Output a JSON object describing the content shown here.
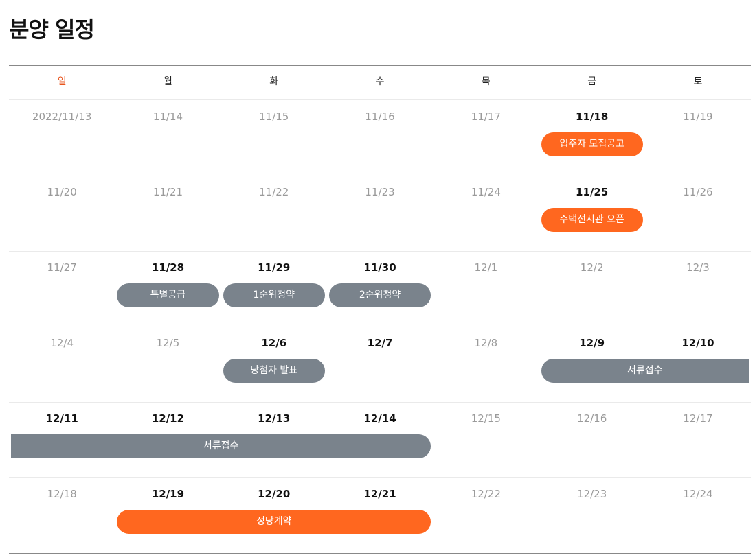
{
  "page": {
    "title": "분양 일정"
  },
  "colors": {
    "accent": "#ff671f",
    "neutral": "#7a838c",
    "sunday": "#e8551e"
  },
  "calendar": {
    "weekdays": [
      "일",
      "월",
      "화",
      "수",
      "목",
      "금",
      "토"
    ],
    "weeks": [
      {
        "dates": [
          {
            "label": "2022/11/13",
            "active": false
          },
          {
            "label": "11/14",
            "active": false
          },
          {
            "label": "11/15",
            "active": false
          },
          {
            "label": "11/16",
            "active": false
          },
          {
            "label": "11/17",
            "active": false
          },
          {
            "label": "11/18",
            "active": true
          },
          {
            "label": "11/19",
            "active": false
          }
        ],
        "events": [
          {
            "label": "입주자 모집공고",
            "color": "orange",
            "start": 5,
            "end": 5
          }
        ]
      },
      {
        "dates": [
          {
            "label": "11/20",
            "active": false
          },
          {
            "label": "11/21",
            "active": false
          },
          {
            "label": "11/22",
            "active": false
          },
          {
            "label": "11/23",
            "active": false
          },
          {
            "label": "11/24",
            "active": false
          },
          {
            "label": "11/25",
            "active": true
          },
          {
            "label": "11/26",
            "active": false
          }
        ],
        "events": [
          {
            "label": "주택전시관 오픈",
            "color": "orange",
            "start": 5,
            "end": 5
          }
        ]
      },
      {
        "dates": [
          {
            "label": "11/27",
            "active": false
          },
          {
            "label": "11/28",
            "active": true
          },
          {
            "label": "11/29",
            "active": true
          },
          {
            "label": "11/30",
            "active": true
          },
          {
            "label": "12/1",
            "active": false
          },
          {
            "label": "12/2",
            "active": false
          },
          {
            "label": "12/3",
            "active": false
          }
        ],
        "events": [
          {
            "label": "특별공급",
            "color": "gray",
            "start": 1,
            "end": 1
          },
          {
            "label": "1순위청약",
            "color": "gray",
            "start": 2,
            "end": 2
          },
          {
            "label": "2순위청약",
            "color": "gray",
            "start": 3,
            "end": 3
          }
        ]
      },
      {
        "dates": [
          {
            "label": "12/4",
            "active": false
          },
          {
            "label": "12/5",
            "active": false
          },
          {
            "label": "12/6",
            "active": true
          },
          {
            "label": "12/7",
            "active": true
          },
          {
            "label": "12/8",
            "active": false
          },
          {
            "label": "12/9",
            "active": true
          },
          {
            "label": "12/10",
            "active": true
          }
        ],
        "events": [
          {
            "label": "당첨자 발표",
            "color": "gray",
            "start": 2,
            "end": 2
          },
          {
            "label": "서류접수",
            "color": "gray",
            "start": 5,
            "end": 6,
            "continues": true
          }
        ]
      },
      {
        "dates": [
          {
            "label": "12/11",
            "active": true
          },
          {
            "label": "12/12",
            "active": true
          },
          {
            "label": "12/13",
            "active": true
          },
          {
            "label": "12/14",
            "active": true
          },
          {
            "label": "12/15",
            "active": false
          },
          {
            "label": "12/16",
            "active": false
          },
          {
            "label": "12/17",
            "active": false
          }
        ],
        "events": [
          {
            "label": "서류접수",
            "color": "gray",
            "start": 0,
            "end": 3,
            "continued": true
          }
        ]
      },
      {
        "dates": [
          {
            "label": "12/18",
            "active": false
          },
          {
            "label": "12/19",
            "active": true
          },
          {
            "label": "12/20",
            "active": true
          },
          {
            "label": "12/21",
            "active": true
          },
          {
            "label": "12/22",
            "active": false
          },
          {
            "label": "12/23",
            "active": false
          },
          {
            "label": "12/24",
            "active": false
          }
        ],
        "events": [
          {
            "label": "정당계약",
            "color": "orange",
            "start": 1,
            "end": 3
          }
        ]
      }
    ]
  }
}
